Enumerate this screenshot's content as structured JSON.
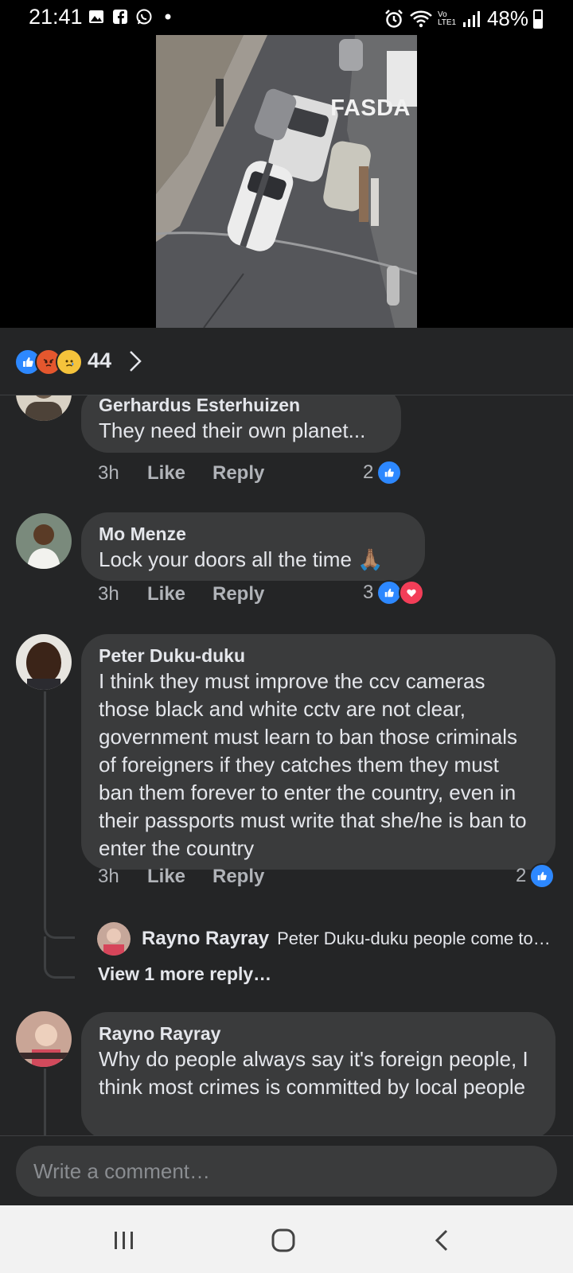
{
  "status_bar": {
    "time": "21:41",
    "battery": "48%",
    "network": "Vo LTE1",
    "left_icons": [
      "gallery-icon",
      "facebook-icon",
      "whatsapp-icon",
      "dot-icon"
    ],
    "right_icons": [
      "alarm-icon",
      "wifi-icon",
      "signal-icon",
      "battery-icon"
    ]
  },
  "video": {
    "watermark": "FASDA"
  },
  "reactions": {
    "count": "44",
    "types": [
      "like",
      "angry",
      "sad"
    ]
  },
  "comments": [
    {
      "author": "Gerhardus Esterhuizen",
      "text": "They need their own planet...",
      "time": "3h",
      "like_label": "Like",
      "reply_label": "Reply",
      "reaction_count": "2",
      "reactions": [
        "like"
      ]
    },
    {
      "author": "Mo Menze",
      "text": "Lock your doors all the time 🙏🏽",
      "time": "3h",
      "like_label": "Like",
      "reply_label": "Reply",
      "reaction_count": "3",
      "reactions": [
        "like",
        "love"
      ]
    },
    {
      "author": "Peter Duku-duku",
      "text": "I think they must improve the ccv cameras those black and white cctv are not clear, government must learn to ban those criminals of foreigners if they catches them they must ban them forever to enter the country, even in their passports must write that she/he is ban to enter the country",
      "time": "3h",
      "like_label": "Like",
      "reply_label": "Reply",
      "reaction_count": "2",
      "reactions": [
        "like"
      ],
      "reply_preview": {
        "author": "Rayno Rayray",
        "text": "Peter Duku-duku people come to…"
      },
      "more_replies": "View 1 more reply…"
    },
    {
      "author": "Rayno Rayray",
      "text": "Why do people always say it's foreign people, I think  most crimes is committed by local people"
    }
  ],
  "composer": {
    "placeholder": "Write a comment…"
  },
  "colors": {
    "background": "#242526",
    "bubble": "#3a3b3c",
    "like_blue": "#2d88ff",
    "love_red": "#f33e58",
    "muted_text": "#b0b3b8"
  }
}
